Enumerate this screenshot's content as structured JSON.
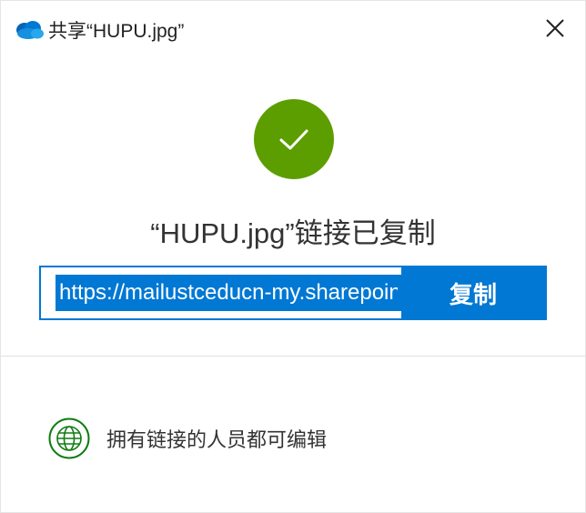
{
  "window": {
    "title": "共享“HUPU.jpg”",
    "app_icon": "onedrive-cloud-icon",
    "close_icon": "close-icon"
  },
  "main": {
    "status_icon": "checkmark-icon",
    "status_text": "“HUPU.jpg”链接已复制",
    "link_value": "https://mailustceducn-my.sharepoint.com",
    "copy_label": "复制"
  },
  "footer": {
    "permission_icon": "globe-icon",
    "permission_text": "拥有链接的人员都可编辑"
  },
  "colors": {
    "accent": "#0078d4",
    "success": "#5c9e00",
    "globe_green": "#107c10",
    "cloud_blue": "#0364b8"
  }
}
